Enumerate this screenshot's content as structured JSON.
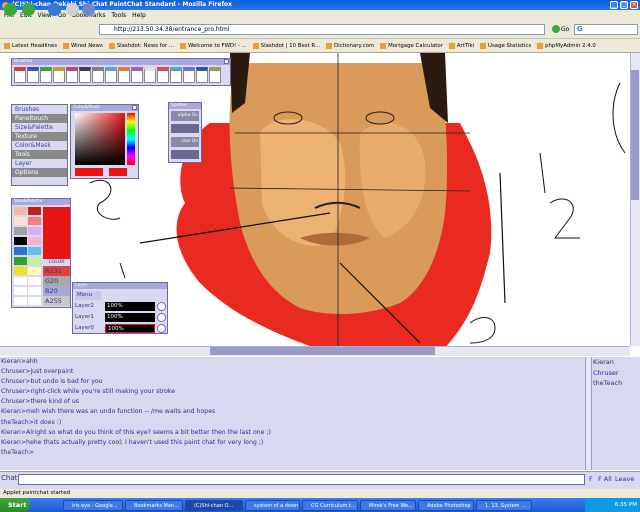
{
  "window": {
    "title": "(C)Shi-chan Oekaki Shi-Chat PaintChat Standard - Mozilla Firefox"
  },
  "menu": [
    "File",
    "Edit",
    "View",
    "Go",
    "Bookmarks",
    "Tools",
    "Help"
  ],
  "url": "http://213.50.34.38/entrance_pro.html",
  "go_label": "Go",
  "search_letter": "G",
  "bookmarks": [
    "Latest Headlines",
    "Wired News",
    "Slashdot: News for ...",
    "Welcome to FWD! - ...",
    "Slashdot | 10 Best R...",
    "Dictionary.com",
    "Mortgage Calculator",
    "ArtTiki",
    "Usage Statistics",
    "phpMyAdmin 2.4.0"
  ],
  "panels": {
    "brushes_title": "Brushes",
    "colormask_title": "Color&Mask",
    "splitter_title": "Splitter",
    "alpha_label": "alpha On",
    "size_label": "size On",
    "sizepalette_title": "Size&Palette",
    "main_menu": [
      "Brushes",
      "Paneltouch",
      "Size&Palette",
      "Texture",
      "Color&Mask",
      "Tools",
      "Layer",
      "Options"
    ],
    "rgba": [
      "R231",
      "G20",
      "B20",
      "A255"
    ],
    "color_label": "COLOR",
    "layer_title": "Layer",
    "layer_menu": "Menu",
    "layers": [
      {
        "name": "Layer2",
        "opacity": "100%"
      },
      {
        "name": "Layer1",
        "opacity": "100%"
      },
      {
        "name": "Layer0",
        "opacity": "100%"
      }
    ]
  },
  "chat": {
    "messages": [
      "Kieran>ahh",
      "Chruser>just overpaint",
      "Chruser>but undo is bad for you",
      "Chruser>right-click while you're still making your stroke",
      "Chruser>there kind of us",
      "Kieran>meh wish there was an undo function -- /me waits and hopes",
      "theTeach>it does :)",
      "Kieran>Alright so what do you think of this eye? seems a bit better then the last one ;)",
      "Kieran>hehe thats actually pretty cool; I haven't used this paint chat for very long ;)",
      "theTeach>"
    ],
    "users": [
      "Kieran",
      "Chruser",
      "theTeach"
    ],
    "input_label": "Chat:",
    "buttons": [
      "F",
      "F All",
      "Leave"
    ]
  },
  "status": "Applet paintchat started",
  "taskbar": {
    "start": "Start",
    "tasks": [
      "iris eye - Google...",
      "Bookmarks Man...",
      "(C)Shi-chan O...",
      "system of a down",
      "CG Curriculum.t...",
      "Mirek's Free We...",
      "Adobe Photoshop",
      "1. 13..System ..."
    ],
    "clock": "6:35 PM"
  },
  "colors": {
    "accent": "#0a5ddc",
    "panel_bg": "#d8d8f0",
    "chat_text": "#30308a",
    "selected_red": "#e71414"
  }
}
